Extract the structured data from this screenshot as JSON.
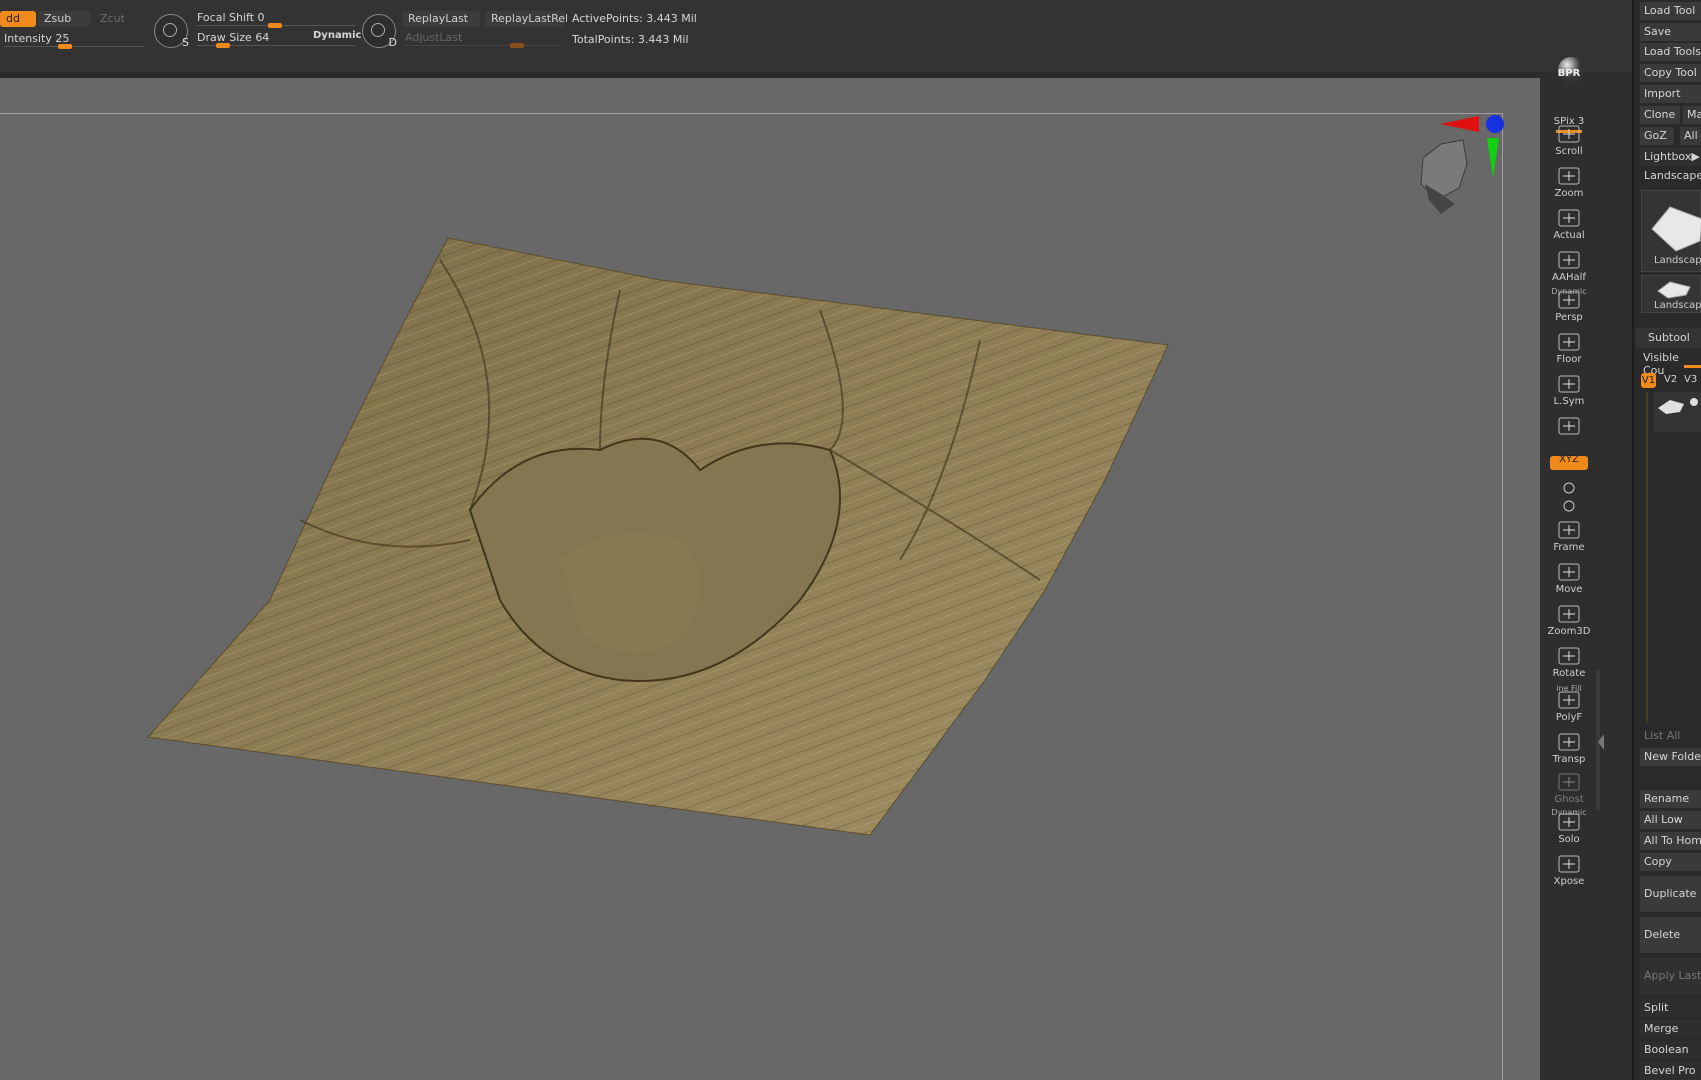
{
  "topbar": {
    "mode_buttons": {
      "zadd": "dd",
      "zsub": "Zsub",
      "zcut": "Zcut"
    },
    "intensity": {
      "label": "Intensity",
      "value": "25",
      "fraction": 0.25
    },
    "focal_shift": {
      "label": "Focal Shift",
      "value": "0",
      "fraction": 0.5
    },
    "draw_size": {
      "label": "Draw Size",
      "value": "64",
      "fraction": 0.25
    },
    "dynamic_label": "Dynamic",
    "replay_last": "ReplayLast",
    "replay_last_rel": "ReplayLastRel",
    "adjust_last": {
      "label": "AdjustLast",
      "fraction": 0.6
    },
    "active_points": "ActivePoints: 3.443 Mil",
    "total_points": "TotalPoints: 3.443 Mil",
    "s_icon_letter": "S",
    "d_icon_letter": "D"
  },
  "shelf": {
    "items": [
      {
        "label": "BPR",
        "icon": "bpr-sphere-icon"
      },
      {
        "label": "SPix 3",
        "icon": "spix-slider-icon"
      },
      {
        "label": "Scroll",
        "icon": "scroll-hand-icon"
      },
      {
        "label": "Zoom",
        "icon": "zoom-magnifier-icon"
      },
      {
        "label": "Actual",
        "icon": "actual-magnifier-icon"
      },
      {
        "label": "AAHalf",
        "icon": "aahalf-magnifier-icon"
      },
      {
        "label": "Persp",
        "icon": "perspective-grid-icon"
      },
      {
        "label": "Floor",
        "icon": "floor-grid-icon"
      },
      {
        "label": "L.Sym",
        "icon": "local-symmetry-icon"
      },
      {
        "label": "",
        "icon": "lock-camera-icon"
      },
      {
        "label": "XYZ",
        "icon": "xyz-rotate-icon"
      },
      {
        "label": "",
        "icon": "rotate-y-icon"
      },
      {
        "label": "",
        "icon": "rotate-z-icon"
      },
      {
        "label": "Frame",
        "icon": "frame-icon"
      },
      {
        "label": "Move",
        "icon": "move-hand-icon"
      },
      {
        "label": "Zoom3D",
        "icon": "zoom3d-icon"
      },
      {
        "label": "Rotate",
        "icon": "rotate-icon"
      },
      {
        "label": "PolyF",
        "icon": "polyframe-icon"
      },
      {
        "label": "Transp",
        "icon": "transparency-icon"
      },
      {
        "label": "Ghost",
        "icon": "ghost-icon"
      },
      {
        "label": "Solo",
        "icon": "solo-icon"
      },
      {
        "label": "Xpose",
        "icon": "xpose-icon"
      }
    ],
    "dynamic_small_1": "Dynamic",
    "dynamic_small_2": "Dynamic",
    "line_fill_small": "ine Fill"
  },
  "panel": {
    "load_tool": "Load Tool",
    "save": "Save",
    "load_tools": "Load Tools",
    "copy_tool": "Copy Tool",
    "import": "Import",
    "clone": "Clone",
    "make": "Ma",
    "goz": "GoZ",
    "all": "All",
    "lightbox": "Lightbox▶",
    "landscape_header": "Landscape",
    "thumb1_label": "Landscap",
    "thumb2_label": "Landscap",
    "subtool": "Subtool",
    "visible_count": "Visible Cou",
    "v1": "V1",
    "v2": "V2",
    "v3": "V3",
    "list_all": "List All",
    "new_folder": "New Folde",
    "rename": "Rename",
    "all_low": "All Low",
    "all_to_home": "All To Hom",
    "copy": "Copy",
    "duplicate": "Duplicate",
    "delete": "Delete",
    "apply_last": "Apply Last",
    "split": "Split",
    "merge": "Merge",
    "boolean": "Boolean",
    "bevel_pro": "Bevel Pro"
  },
  "colors": {
    "accent": "#f08a1c",
    "terrain": "#8c7a52",
    "canvas": "#686868",
    "axis_x": "#e01010",
    "axis_y": "#10d010",
    "axis_z": "#1020e0"
  }
}
